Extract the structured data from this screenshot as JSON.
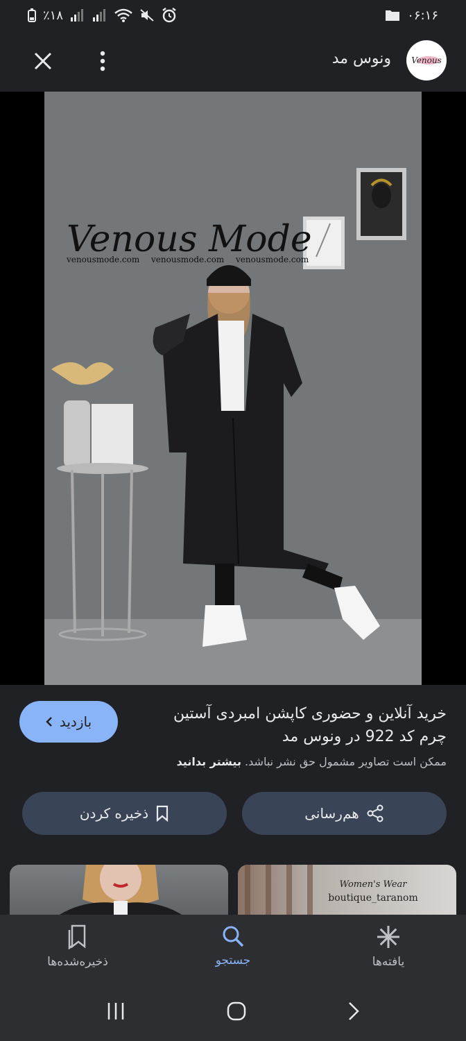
{
  "status": {
    "time": "۰۶:۱۶",
    "battery": "٪۱۸"
  },
  "header": {
    "site_name": "ونوس مد",
    "logo_text": "Venous"
  },
  "image": {
    "watermark_brand": "Venous Mode",
    "watermark_urls": [
      "venousmode.com",
      "venousmode.com",
      "venousmode.com"
    ]
  },
  "info": {
    "visit_label": "بازدید",
    "title": "خرید آنلاین و حضوری کاپشن امبردی آستین چرم کد 922 در ونوس مد",
    "copyright_text": "ممکن است تصاویر مشمول حق نشر نباشد.",
    "learn_more": "بیشتر بدانید"
  },
  "actions": {
    "share_label": "هم‌رسانی",
    "save_label": "ذخیره کردن"
  },
  "thumbnails": {
    "right_caption_1": "Women's Wear",
    "right_caption_2": "boutique_taranom"
  },
  "bottom_nav": {
    "items": [
      {
        "label": "یافته‌ها",
        "icon": "asterisk-icon"
      },
      {
        "label": "جستجو",
        "icon": "search-icon"
      },
      {
        "label": "ذخیره‌شده‌ها",
        "icon": "bookmarks-icon"
      }
    ]
  },
  "colors": {
    "background": "#202124",
    "accent": "#8ab4f8",
    "button": "#394457"
  }
}
